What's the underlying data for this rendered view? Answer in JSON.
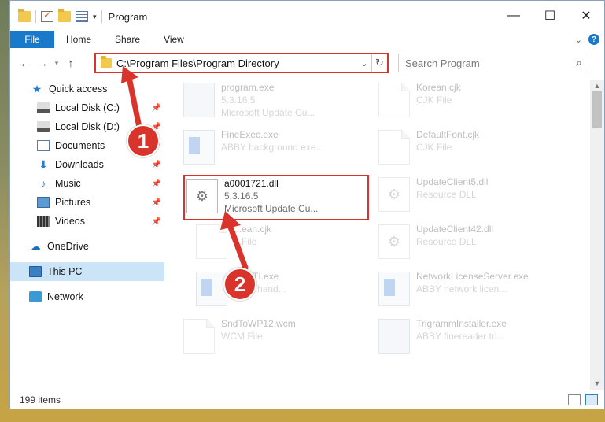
{
  "window": {
    "title": "Program"
  },
  "ribbon": {
    "tabs": [
      "File",
      "Home",
      "Share",
      "View"
    ]
  },
  "address": {
    "path": "C:\\Program Files\\Program Directory",
    "search_placeholder": "Search Program"
  },
  "sidebar": {
    "items": [
      {
        "label": "Quick access",
        "icon": "star-icon",
        "pinned": false
      },
      {
        "label": "Local Disk (C:)",
        "icon": "disk-icon",
        "pinned": true
      },
      {
        "label": "Local Disk (D:)",
        "icon": "disk-icon",
        "pinned": true
      },
      {
        "label": "Documents",
        "icon": "documents-icon",
        "pinned": true
      },
      {
        "label": "Downloads",
        "icon": "downloads-icon",
        "pinned": true
      },
      {
        "label": "Music",
        "icon": "music-icon",
        "pinned": true
      },
      {
        "label": "Pictures",
        "icon": "pictures-icon",
        "pinned": true
      },
      {
        "label": "Videos",
        "icon": "videos-icon",
        "pinned": true
      },
      {
        "label": "OneDrive",
        "icon": "onedrive-icon",
        "pinned": false
      },
      {
        "label": "This PC",
        "icon": "this-pc-icon",
        "pinned": false,
        "selected": true
      },
      {
        "label": "Network",
        "icon": "network-icon",
        "pinned": false
      }
    ]
  },
  "files": [
    {
      "name": "program.exe",
      "meta1": "5.3.16.5",
      "meta2": "Microsoft Update Cu...",
      "icon": "installer-icon",
      "faded": true
    },
    {
      "name": "Korean.cjk",
      "meta1": "CJK File",
      "meta2": "",
      "icon": "file-icon",
      "faded": true
    },
    {
      "name": "FineExec.exe",
      "meta1": "ABBY background exe...",
      "meta2": "",
      "icon": "app-icon",
      "faded": true
    },
    {
      "name": "DefaultFont.cjk",
      "meta1": "CJK File",
      "meta2": "",
      "icon": "file-icon",
      "faded": true
    },
    {
      "name": "a0001721.dll",
      "meta1": "5.3.16.5",
      "meta2": "Microsoft Update Cu...",
      "icon": "gear-file-icon",
      "faded": false
    },
    {
      "name": "UpdateClient5.dll",
      "meta1": "Resource DLL",
      "meta2": "",
      "icon": "gear-file-icon",
      "faded": true
    },
    {
      "name": "...ean.cjk",
      "meta1": "...File",
      "meta2": "",
      "icon": "file-icon",
      "faded": true
    },
    {
      "name": "UpdateClient42.dll",
      "meta1": "Resource DLL",
      "meta2": "",
      "icon": "gear-file-icon",
      "faded": true
    },
    {
      "name": "...ySTI.exe",
      "meta1": "...ent hand...",
      "meta2": "",
      "icon": "app-icon",
      "faded": true
    },
    {
      "name": "NetworkLicenseServer.exe",
      "meta1": "ABBY network licen...",
      "meta2": "",
      "icon": "app-icon",
      "faded": true
    },
    {
      "name": "SndToWP12.wcm",
      "meta1": "WCM File",
      "meta2": "",
      "icon": "file-icon",
      "faded": true
    },
    {
      "name": "TrigrammInstaller.exe",
      "meta1": "ABBY finereader tri...",
      "meta2": "",
      "icon": "installer-icon",
      "faded": true
    }
  ],
  "status": {
    "item_count": "199 items"
  },
  "callouts": {
    "one": "1",
    "two": "2"
  },
  "colors": {
    "accent": "#1979ca",
    "highlight": "#d9342b",
    "selected": "#cce4f7"
  }
}
